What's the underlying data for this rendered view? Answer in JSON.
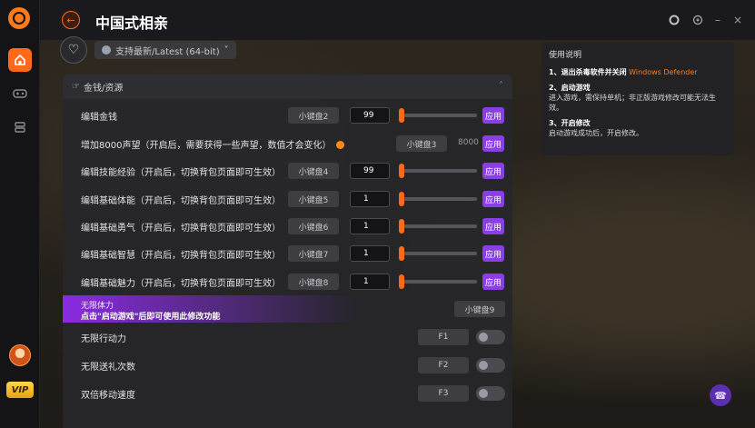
{
  "app": {
    "title": "中国式相亲",
    "back_icon": "arrow-left-icon"
  },
  "toolbar": {
    "version_label": "支持最新/Latest (64-bit)"
  },
  "section": {
    "title": "金钱/资源"
  },
  "rows": [
    {
      "label": "编辑金钱",
      "hotkey": "小键盘2",
      "value": "99",
      "apply": "应用"
    },
    {
      "label": "增加8000声望（开启后，需要获得一些声望，数值才会变化）",
      "hotkey": "小键盘3",
      "static_value": "8000",
      "apply": "应用"
    },
    {
      "label": "编辑技能经验（开启后，切换背包页面即可生效）",
      "hotkey": "小键盘4",
      "value": "99",
      "apply": "应用"
    },
    {
      "label": "编辑基础体能（开启后，切换背包页面即可生效）",
      "hotkey": "小键盘5",
      "value": "1",
      "apply": "应用"
    },
    {
      "label": "编辑基础勇气（开启后，切换背包页面即可生效）",
      "hotkey": "小键盘6",
      "value": "1",
      "apply": "应用"
    },
    {
      "label": "编辑基础智慧（开启后，切换背包页面即可生效）",
      "hotkey": "小键盘7",
      "value": "1",
      "apply": "应用"
    },
    {
      "label": "编辑基础魅力（开启后，切换背包页面即可生效）",
      "hotkey": "小键盘8",
      "value": "1",
      "apply": "应用"
    }
  ],
  "promo": {
    "title": "无限体力",
    "subtitle": "点击\"启动游戏\"后即可使用此修改功能",
    "hotkey": "小键盘9"
  },
  "toggles": [
    {
      "label": "无限行动力",
      "hotkey": "F1"
    },
    {
      "label": "无限送礼次数",
      "hotkey": "F2"
    },
    {
      "label": "双倍移动速度",
      "hotkey": "F3"
    }
  ],
  "help": {
    "title": "使用说明",
    "step1_title": "1、退出杀毒软件并关闭",
    "step1_highlight": "Windows Defender",
    "step2_title": "2、启动游戏",
    "step2_text": "进入游戏，需保持单机；非正版游戏修改可能无法生效。",
    "step3_title": "3、开启修改",
    "step3_text": "启动游戏成功后，开启修改。"
  },
  "colors": {
    "accent": "#ff6a1a",
    "apply": "#8a3ee6",
    "vip": "#ffc629"
  },
  "sidebar": {
    "vip_label": "VIP"
  }
}
